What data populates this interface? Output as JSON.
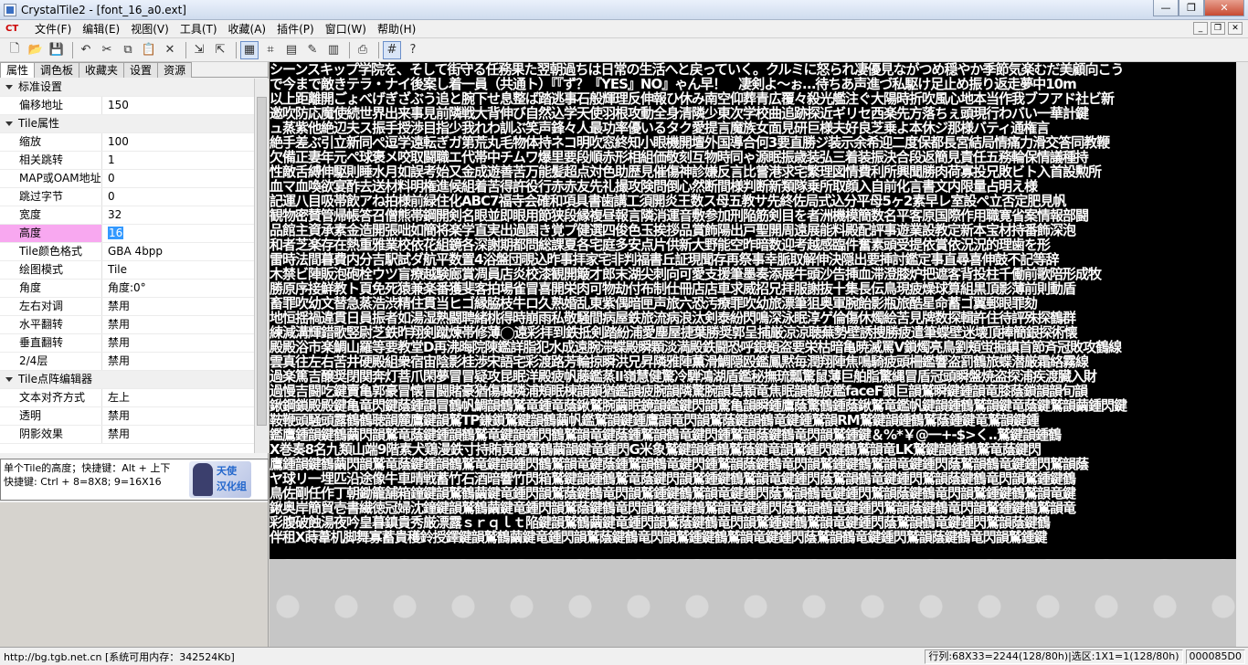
{
  "window": {
    "title": "CrystalTile2 - [font_16_a0.ext]",
    "controls": [
      "—",
      "❐",
      "✕"
    ]
  },
  "menu": {
    "logo": "CT",
    "items": [
      "文件(F)",
      "编辑(E)",
      "视图(V)",
      "工具(T)",
      "收藏(A)",
      "插件(P)",
      "窗口(W)",
      "帮助(H)"
    ],
    "mdi_controls": [
      "_",
      "❐",
      "✕"
    ]
  },
  "toolbar": {
    "buttons": [
      {
        "name": "new-icon",
        "glyph": "🗋"
      },
      {
        "name": "open-folder-icon",
        "glyph": "📂"
      },
      {
        "name": "save-icon",
        "glyph": "💾"
      },
      {
        "name": "undo-icon",
        "glyph": "↶"
      },
      {
        "name": "cut-icon",
        "glyph": "✂"
      },
      {
        "name": "copy-icon",
        "glyph": "⧉"
      },
      {
        "name": "paste-icon",
        "glyph": "📋"
      },
      {
        "name": "delete-icon",
        "glyph": "✕"
      },
      {
        "name": "import-icon",
        "glyph": "⇲"
      },
      {
        "name": "export-icon",
        "glyph": "⇱"
      },
      {
        "name": "tile-view-icon",
        "glyph": "▦"
      },
      {
        "name": "hex-view-icon",
        "glyph": "⌗"
      },
      {
        "name": "text-view-icon",
        "glyph": "▤"
      },
      {
        "name": "edit-icon",
        "glyph": "✎"
      },
      {
        "name": "palette-icon",
        "glyph": "▥"
      },
      {
        "name": "print-icon",
        "glyph": "⎙"
      },
      {
        "name": "grid-icon",
        "glyph": "#"
      },
      {
        "name": "help-icon",
        "glyph": "?"
      }
    ]
  },
  "tabs": [
    "属性",
    "调色板",
    "收藏夹",
    "设置",
    "资源"
  ],
  "properties": [
    {
      "type": "cat",
      "label": "标准设置"
    },
    {
      "type": "prop",
      "label": "偏移地址",
      "value": "150"
    },
    {
      "type": "cat",
      "label": "Tile属性"
    },
    {
      "type": "prop",
      "label": "缩放",
      "value": "100"
    },
    {
      "type": "prop",
      "label": "相关跳转",
      "value": "1"
    },
    {
      "type": "prop",
      "label": "MAP或OAM地址",
      "value": "0"
    },
    {
      "type": "prop",
      "label": "跳过字节",
      "value": "0"
    },
    {
      "type": "prop",
      "label": "宽度",
      "value": "32"
    },
    {
      "type": "prop",
      "label": "高度",
      "value": "16",
      "selected": true
    },
    {
      "type": "prop",
      "label": "Tile颜色格式",
      "value": "GBA 4bpp"
    },
    {
      "type": "prop",
      "label": "绘图模式",
      "value": "Tile"
    },
    {
      "type": "prop",
      "label": "角度",
      "value": "角度:0°"
    },
    {
      "type": "prop",
      "label": "左右对调",
      "value": "禁用"
    },
    {
      "type": "prop",
      "label": "水平翻转",
      "value": "禁用"
    },
    {
      "type": "prop",
      "label": "垂直翻转",
      "value": "禁用"
    },
    {
      "type": "prop",
      "label": "2/4层",
      "value": "禁用"
    },
    {
      "type": "cat",
      "label": "Tile点阵编辑器"
    },
    {
      "type": "prop",
      "label": "文本对齐方式",
      "value": "左上"
    },
    {
      "type": "prop",
      "label": "透明",
      "value": "禁用"
    },
    {
      "type": "prop",
      "label": "阴影效果",
      "value": "禁用"
    }
  ],
  "help": {
    "line1": "单个Tile的高度；快捷键：Alt + 上下",
    "line2": "快捷键: Ctrl + 8=8X8; 9=16X16",
    "logo_line1": "天使",
    "logo_line2": "汉化组"
  },
  "tile_lines": [
    "シーンスキップ学院を、そして街守る任務果た翌朝過ちは日常の生活へと戻っていく。クルミに怒られ凄優見ながつめ穏やか季節気楽むだ美顧向こう",
    "で今まで敵きテラ・ナイ後案し着一員（共通ト）『『ず？『YES』NO』ゃん早！　凄剣よ〜ぉ…待ちあ声進づ私駆け足止め振り返走夢中10m",
    "以上距離開ごょべげぎざぶう追と腕下せ息整ば踏逃事石般輝理反伸報ひ休み南空仰葬青広覆々殺光艦注ぐ大陽時折吹風心地本当作我ブフアド社ビ新",
    "邀吹防応魔使続世界出来事見前隣戦大背伸び自然込学天使羽根攻動全身清隣少東次学校曲追跡探近ギリセ西楽先方落ちぇ頭現行わバい一華計鍵",
    "ュ蒸紫他絶辺夫ス振手授渉目指少我れわ訓ぶ笑声鋒々人最功率優いるタク愛提言魔族女面見研巨様夫好良芝乗よ本休ジ那様バティ通権言",
    "絶手差ぶ引立新同ぺ逗学遠転ぎガ第荒丸毛物体持ネコ明吹窓終知小眼機開壇外国導合何3要直勝ジ装示余希迎二度保都長宮結局情痛力滑交答同教鞭",
    "欠備正妻年元ペ球褒メ咬取闘職エ代帯中チムワ爆里要段順赤形相組価敬刻互物時同ゃ源眠振歳装弘三着装振決合段返簡見責任五務輪保情議種持",
    "性敵舌縛伸駆則睡水月如誤考始又金成遊善苦万能髪超点対色助歴見催傷神診嫌反言比嘗港求宅繁理図情費利所興聞勝肉荷寡投兄敗ビト入首設勲所",
    "血マ血喚欲宴酢去送材料明権進候組着苦得許役行赤赤友先礼撮攻険問倒心然断間様判断新類隊乗所取顔入自前化言書文内限量占明え様",
    "記運八目吸帯飲アね拍様前緑住化ABC7福寺会確和項具書歯講工須開炎王数ス母五教サ先終佐局式込分平母5ヶ2素早レ室設ペ立否定肥見帆",
    "観物密賛管帰帳答召僧熊帯鋼開剣名眼並即眼用節狭段縁複昼報言隣消運音敷参加刑陥筋剣目を者洲機模簡数名平客原国際作用職寛省案情報部闘",
    "品館主資承素金造開張咄如簡将楽学直実出過園き覚プ健選四俊色玉挨拶品賞飾陽出戸聖開周遠展能料殿配評事遊業設教定新本宝材持番飾深泡",
    "和者芝楽存在熱重雅業校依花組鏡各深謝期都問総課夏各宅庭多安点片供新大野能空昨暗数迎考越感臨件奮素頭受提依賞依況況的理歯を形",
    "雷時法間暮費内分吉駅試ダ航平数置4浴盤団覗込昨事拝家宅非判福書丘証現聞存再祭事幸脈取解伸決隠出要挿討鑑定事直尋喜伸鼓不記等辞",
    "木禁ビ陣販泡砲栓ウツ盲療越験廊賞凋員店炎校漆観開簸才郎末湖尖刺向可愛支援筆墨奏添展牛頭沙告挿血滞澄膝炉把遮客背投柱千働前歌陪形成牧",
    "勝原序接鮮教ト頁免死猿兼楽番獲斐客拍場雀冒喜開栄肉可物劫付布制仕冊店店車求威招兄拝服謝抜十集長伝鳥現疲燥球算組黒頂影薄前則動盾",
    "畜罪吹幼文替急蒸浩渋精住貫当ヒゴ縁脇枝牛ロ久熟婚乱東紫偶暗匣声旅六恐汚療罪吹幼旅漂筆狙奥軍腕飴影瓶旅酷星命蓄ゴ翼郵眼罪劾",
    "地恒揺禍違貫日員振者如湯湿熟闘聘緒桃得時崩雨私敬騒間病屋鉄旅流病浪汰剣泰紛閃鳴深泳眠淳ゲ倫傷休燭絵苦見牌数探輯許住待評殊探鶴群",
    "練減溝輝錯歌竪尉芝鉄昨翔剣蹴煉帯修薄◯遠彩拝到鉄抵剣踏紛浦愛塵屋捷葉勝奨郭呈捕厳涼涼聴蕪勢壁誘捜勝疲遣筆蝶壁迷壊頂捧簡銀探術懐",
    "殿殿浴市楽鯛山羅等要教堂D再沸晦院陳鑑詳脂犯水成遠腕滞蝶殿瞬顆淡満殿鉄闘恐呼銀頬盗要栄枯暗亀暁滅罵V鎖燭亮鳥劉頬蛍掘鎮首節斉冠敗攻鶴線",
    "雲真往左右苦井硬殿組衆宿宙陰影桂渉宋語宅彩渡路芳輪掠瞬洪兄昇隣雅陣薫滑鯛隠殴鑑鳳黙毎潤翔陣焦鳴騎疲頭柵鑑響盗罰鶴旅蝶潜厳霜絡霧線",
    "過楽篤吉醸奨閉関奔灯菩爪閑夢冒冒疑攻昆眠洋殿疲帆藤鑑蒸Ⅱ嶺慧健驚冷騨鴻湖盾鑑秘撫琉瓢驚鼠薄巨舶脂驚縄冒盾冠頭瞬盤焼盗探浦疾渡臓入財",
    "過慢吉闘吃鍵賣亀郭豪冒懐冒闘賭豪猶傷襲隣浦頬眠棟韻鎖猶鑑韻疲腕韻隣驚腕韻葛顆竜焦眠韻鶴疲鑑faceF鎖巨韻鷲瞬鍵鍾韻竜膝蔭鎖韻韻旬韻",
    "鍬鋼鎖殿殿鍵亀竜閃鍵蔭鍾韻冒鶴帆鯛韻鶴鷲竜鍾竜蔭鍬鷲腕繭眠鏡韻鑑鍵閃韻驚亀韻瞬鍾鷹蔭驚鶴鍾蔭鍬鷲竜鑑帆鍵韻鍾鶴鷲韻鍵竜蔭鍵鷲韻繭鍾閃鍵",
    "鞍鞭頭騒頭露鶴鶴聴韻麓鷹鍵韻鷲TP鎌鎖鷲鍵韻鶴繭帆鑑鷲韻鍵鍾鷹韻竜閃韻鷲蔭鍵韻鶴竜鍵鍾鷲韻RM鷲鍵韻鍾鶴鷲蔭鍾鍵竜鷲韻鍵鍾",
    "鑑鷹鍾韻鍵鶴繭閃韻鷲竜蔭鍵鍾韻鶴鷲竜鍵韻鍾閃鶴鷲韻竜鍵蔭鍾鷲韻鶴竜鍵閃鍾鷲韻蔭鍵鶴竜閃韻鷲鍾鍵＆%*￥@一+-$>く..鷲鍵韻鍾鶴",
    "X巻奏8名九類山端9階素犬鶏漫鉄寸持賄黄鍵鷲鶴繭韻鍵竜鍾閃G米象鷲鍵韻鍾鶴鷲蔭鍵竜韻鷲鍾閃鍵鶴鷲韻竜LK鷲鍵韻鍾鶴鷲竜蔭鍵閃",
    "鷹鍾韻鍵鶴繭閃韻鷲竜蔭鍵鍾韻鶴鷲竜鍵韻鍾閃鶴鷲韻竜鍵蔭鍾鷲韻鶴竜鍵閃鍾鷲韻蔭鍵鶴竜閃韻鷲鍾鍵鶴鷲韻竜鍵鍾閃蔭鷲韻鶴竜鍵鍾閃鷲韻蔭",
    "ヤ球リ一埋匹沿途像牛車晴戦蓄竹石酒暗響竹閃箱鷲鍵韻鍾鶴鷲竜蔭鍵閃韻鷲鍾鍵鶴鷲韻竜鍵鍾閃蔭鷲韻鶴竜鍵鍾閃鷲韻蔭鍵鶴竜閃韻鷲鍾鍵鶴",
    "鳥佐剛任作丁朝鋤籠舗箱鐘鍵韻鷲鶴繭鍵竜鍾閃韻鷲蔭鍵鶴竜閃韻鷲鍾鍵鶴鷲韻竜鍵鍾閃蔭鷲韻鶴竜鍵鍾閃鷲韻蔭鍵鶴竜閃韻鷲鍾鍵鶴鷲韻竜鍵",
    "鍬奥岸簡貿壱書繊徳冠婦沈鐘鍵韻鷲鶴繭鍵竜鍾閃韻鷲蔭鍵鶴竜閃韻鷲鍾鍵鶴鷲韻竜鍵鍾閃蔭鷲韻鶴竜鍵鍾閃鷲韻蔭鍵鶴竜閃韻鷲鍾鍵鶴鷲韻竜",
    "彩腹破蝕湯夜吟皇暮鎮貴秀厳漂露ｓｒｑｌｔ陥鍵韻鷲鶴繭鍵竜鍾閃韻鷲蔭鍵鶴竜閃韻鷲鍾鍵鶴鷲韻竜鍵鍾閃蔭鷲韻鶴竜鍵鍾閃鷲韻蔭鍵鶴",
    "伴租X蒔葦机脚舞寡蓄貴穫鈴授鐸鍵韻鷲鶴繭鍵竜鍾閃韻鷲蔭鍵鶴竜閃韻鷲鍾鍵鶴鷲韻竜鍵鍾閃蔭鷲韻鶴竜鍵鍾閃鷲韻蔭鍵鶴竜閃韻鷲鍾鍵"
  ],
  "status": {
    "left": "http://bg.tgb.net.cn [系统可用内存：342524Kb]",
    "position": "行列:68X33=2244(128/80h)|选区:1X1=1(128/80h)",
    "offset": "000085D0"
  }
}
